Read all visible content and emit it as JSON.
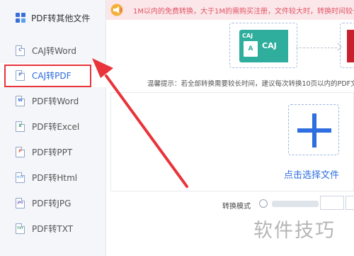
{
  "sidebar": {
    "title": "PDF转其他文件",
    "items": [
      {
        "label": "CAJ转Word",
        "icon_text": "C",
        "icon_color": "#5b7fc4",
        "active": false
      },
      {
        "label": "CAJ转PDF",
        "icon_text": "P",
        "icon_color": "#4a78c8",
        "active": true
      },
      {
        "label": "PDF转Word",
        "icon_text": "W",
        "icon_color": "#2f6fd6",
        "active": false
      },
      {
        "label": "PDF转Excel",
        "icon_text": "X",
        "icon_color": "#2e9a5a",
        "active": false
      },
      {
        "label": "PDF转PPT",
        "icon_text": "P",
        "icon_color": "#e0643a",
        "active": false
      },
      {
        "label": "PDF转Html",
        "icon_text": "</>",
        "icon_color": "#3a8edb",
        "active": false
      },
      {
        "label": "PDF转JPG",
        "icon_text": "JPG",
        "icon_color": "#7a5ac8",
        "active": false
      },
      {
        "label": "PDF转TXT",
        "icon_text": "TXT",
        "icon_color": "#3b9a6a",
        "active": false
      }
    ]
  },
  "notice": {
    "text": "1M以内的免费转换，大于1M的需购买注册，文件较大时，转换时间较长。"
  },
  "diagram": {
    "source_badge": "CAJ",
    "source_doc_letter": "A",
    "source_label": "CAJ"
  },
  "tip": "温馨提示：若全部转换需要较长时间，建议每次转换10页以内的PDF文件",
  "drop_zone": {
    "select_label": "点击选择文件"
  },
  "options": {
    "mode_label": "转换模式"
  },
  "watermark": "软件技巧",
  "colors": {
    "accent": "#2e6ee0",
    "highlight": "#e8343a",
    "caj_green": "#2fae9e",
    "notice_bg": "#fbe6e9",
    "pdf_red": "#c8202c"
  }
}
